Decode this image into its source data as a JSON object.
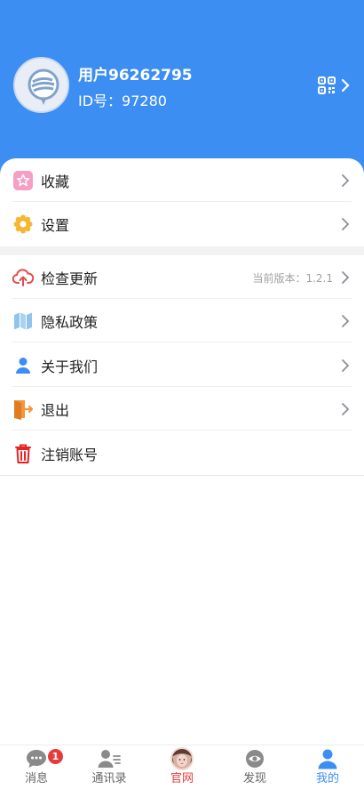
{
  "profile": {
    "username": "用户96262795",
    "id_label": "ID号：97280"
  },
  "menu_group1": [
    {
      "label": "收藏",
      "icon": "star-icon",
      "color": "#f59fc4"
    },
    {
      "label": "设置",
      "icon": "gear-icon",
      "color": "#f6b634"
    }
  ],
  "menu_group2": [
    {
      "label": "检查更新",
      "icon": "cloud-upload-icon",
      "color": "#e84a4a"
    },
    {
      "label": "隐私政策",
      "icon": "map-icon",
      "color": "#8fc5ec"
    },
    {
      "label": "关于我们",
      "icon": "user-icon",
      "color": "#3d8ef3"
    },
    {
      "label": "退出",
      "icon": "exit-door-icon",
      "color": "#f6943a"
    },
    {
      "label": "注销账号",
      "icon": "trash-icon",
      "color": "#e82222"
    }
  ],
  "version": "当前版本：1.2.1",
  "tabs": [
    {
      "label": "消息",
      "icon": "chat-bubble-icon",
      "badge": "1"
    },
    {
      "label": "通讯录",
      "icon": "contacts-icon"
    },
    {
      "label": "官网",
      "icon": "avatar-photo-icon"
    },
    {
      "label": "发现",
      "icon": "eye-icon"
    },
    {
      "label": "我的",
      "icon": "person-icon"
    }
  ],
  "colors": {
    "header": "#3d8ef3",
    "active_tab": "#3d8ef3",
    "badge": "#e63b3b"
  }
}
